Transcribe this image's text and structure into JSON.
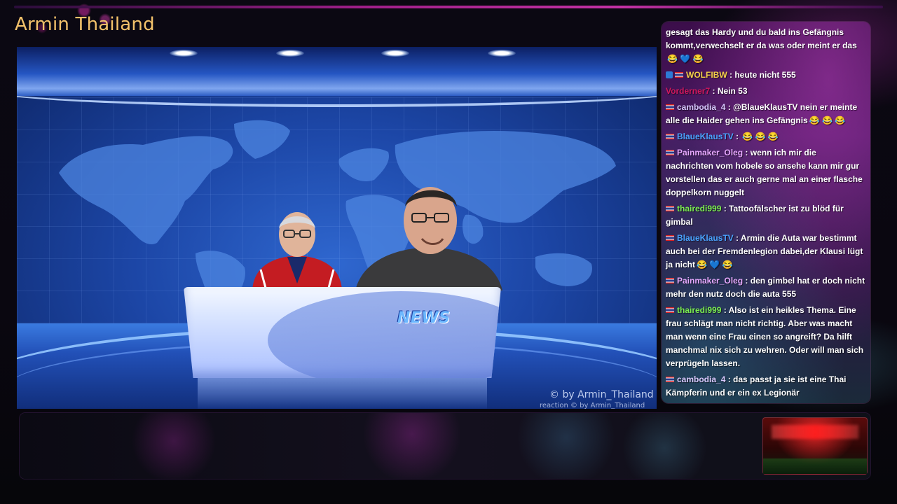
{
  "channel": {
    "title": "Armin Thailand"
  },
  "video": {
    "desk_logo": "NEWS",
    "watermark": "© by Armin_Thailand",
    "watermark_small": "reaction © by Armin_Thailand"
  },
  "chat": {
    "messages": [
      {
        "user": "",
        "user_color": "#ffffff",
        "flag": false,
        "badge": false,
        "text": "gesagt das Hardy und du bald ins Gefängnis kommt,verwechselt er da was oder meint er das",
        "emoji": "😂 💙 😂"
      },
      {
        "user": "WOLFIBW",
        "user_color": "#f5d04a",
        "flag": true,
        "badge": true,
        "text": "heute nicht 555",
        "emoji": ""
      },
      {
        "user": "Vorderner7",
        "user_color": "#d0185e",
        "flag": false,
        "badge": false,
        "text": "Nein 53",
        "emoji": ""
      },
      {
        "user": "cambodia_4",
        "user_color": "#d9c9ff",
        "flag": true,
        "badge": false,
        "text": "@BlaueKlausTV nein er meinte alle die Haider gehen ins Gefängnis",
        "emoji": "😂 😂 😂"
      },
      {
        "user": "BlaueKlausTV",
        "user_color": "#4aa3ff",
        "flag": true,
        "badge": false,
        "text": "",
        "emoji": "😂 😂 😂"
      },
      {
        "user": "Painmaker_Oleg",
        "user_color": "#e7a9ff",
        "flag": true,
        "badge": false,
        "text": "wenn ich mir die nachrichten vom hobele so ansehe kann mir gur vorstellen das er auch gerne mal an einer flasche doppelkorn nuggelt",
        "emoji": ""
      },
      {
        "user": "thairedi999",
        "user_color": "#7cf050",
        "flag": true,
        "badge": false,
        "text": "Tattoofälscher ist zu blöd für gimbal",
        "emoji": ""
      },
      {
        "user": "BlaueKlausTV",
        "user_color": "#4aa3ff",
        "flag": true,
        "badge": false,
        "text": "Armin die Auta war bestimmt auch bei der Fremdenlegion dabei,der Klausi lügt ja nicht",
        "emoji": "😂 💙 😂"
      },
      {
        "user": "Painmaker_Oleg",
        "user_color": "#e7a9ff",
        "flag": true,
        "badge": false,
        "text": "den gimbel hat er doch nicht mehr den nutz doch die auta 555",
        "emoji": ""
      },
      {
        "user": "thairedi999",
        "user_color": "#7cf050",
        "flag": true,
        "badge": false,
        "text": "Also ist ein heikles Thema. Eine frau schlägt man nicht richtig. Aber was macht man wenn eine Frau einen so angreift? Da hilft manchmal nix sich zu wehren. Oder will man sich verprügeln lassen.",
        "emoji": ""
      },
      {
        "user": "cambodia_4",
        "user_color": "#d9c9ff",
        "flag": true,
        "badge": false,
        "text": "das passt ja sie ist eine Thai Kämpferin und er ein ex Legionär",
        "emoji": ""
      }
    ]
  }
}
